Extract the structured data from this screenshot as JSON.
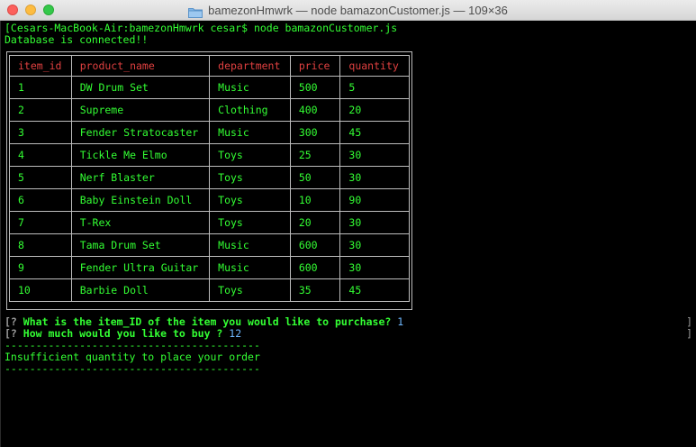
{
  "window": {
    "title": "bamezonHmwrk — node bamazonCustomer.js — 109×36"
  },
  "terminal": {
    "prompt_line": "[Cesars-MacBook-Air:bamezonHmwrk cesar$ node bamazonCustomer.js",
    "db_status": "Database is connected!!",
    "table": {
      "headers": [
        "item_id",
        "product_name",
        "department",
        "price",
        "quantity"
      ],
      "rows": [
        [
          "1",
          "DW Drum Set",
          "Music",
          "500",
          "5"
        ],
        [
          "2",
          "Supreme",
          "Clothing",
          "400",
          "20"
        ],
        [
          "3",
          "Fender Stratocaster",
          "Music",
          "300",
          "45"
        ],
        [
          "4",
          "Tickle Me Elmo",
          "Toys",
          "25",
          "30"
        ],
        [
          "5",
          "Nerf Blaster",
          "Toys",
          "50",
          "30"
        ],
        [
          "6",
          "Baby Einstein Doll",
          "Toys",
          "10",
          "90"
        ],
        [
          "7",
          "T-Rex",
          "Toys",
          "20",
          "30"
        ],
        [
          "8",
          "Tama Drum Set",
          "Music",
          "600",
          "30"
        ],
        [
          "9",
          "Fender Ultra Guitar",
          "Music",
          "600",
          "30"
        ],
        [
          "10",
          "Barbie Doll",
          "Toys",
          "35",
          "45"
        ]
      ]
    },
    "q1_mark": "[?",
    "q1_text": "What is the item_ID of the item you would like to purchase?",
    "q1_answer": "1",
    "q2_mark": "[?",
    "q2_text": "How much would you like to buy ?",
    "q2_answer": "12",
    "right_bracket": "]",
    "divider": "-----------------------------------------",
    "message": "Insufficient quantity to place your order"
  },
  "colors": {
    "text_green": "#33ff33",
    "header_red": "#e04040",
    "answer_blue": "#6fb8ff",
    "border_gray": "#bdbdbd"
  }
}
